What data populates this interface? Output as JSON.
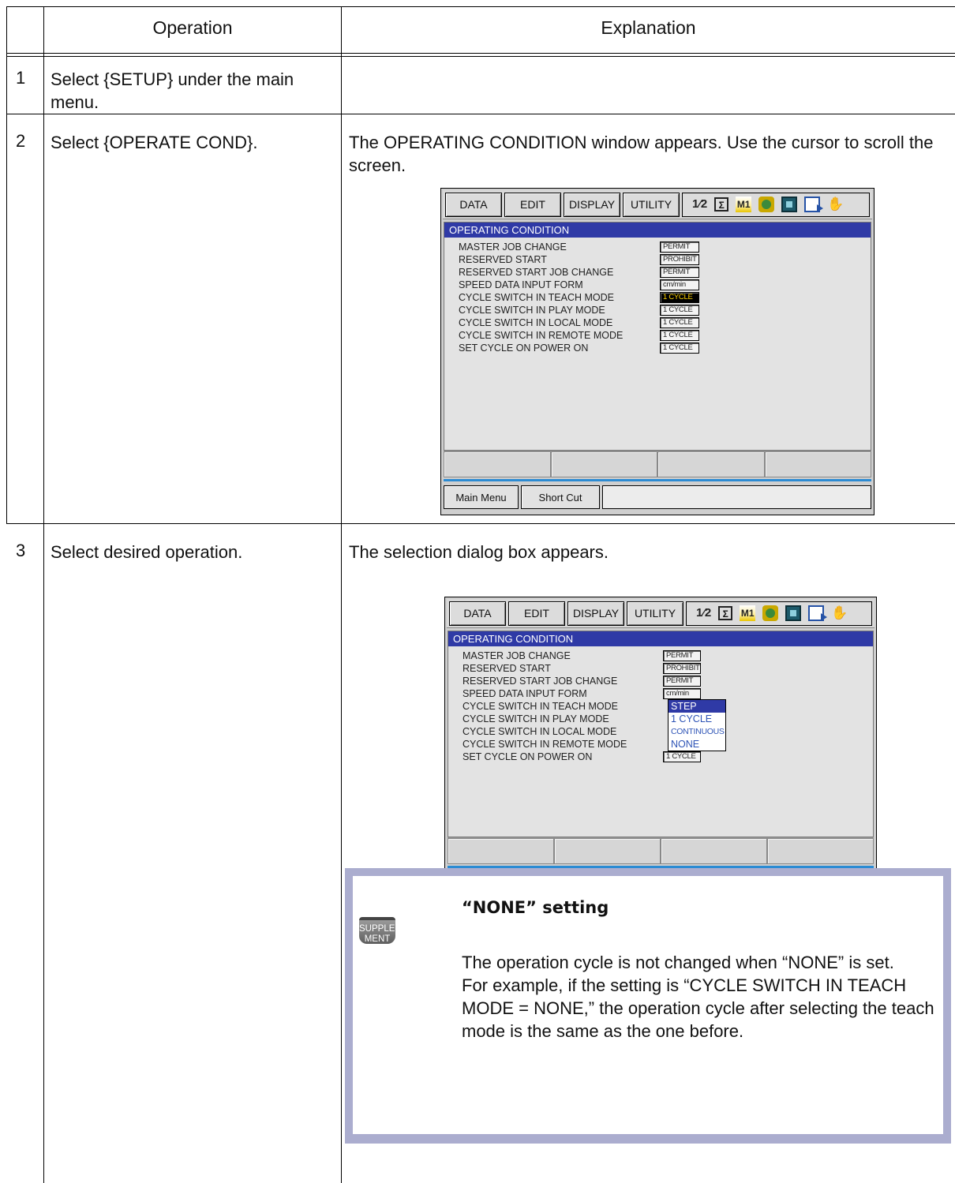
{
  "table": {
    "header": {
      "operation": "Operation",
      "explanation": "Explanation"
    },
    "steps": [
      {
        "number": "1",
        "operation": "Select {SETUP} under the main menu.",
        "explanation": ""
      },
      {
        "number": "2",
        "operation": "Select {OPERATE COND}.",
        "explanation": "The OPERATING CONDITION window appears. Use the cursor to scroll the screen."
      },
      {
        "number": "3",
        "operation": "Select desired operation.",
        "explanation": "The selection dialog box appears."
      }
    ]
  },
  "screen": {
    "menus": [
      "DATA",
      "EDIT",
      "DISPLAY",
      "UTILITY"
    ],
    "status_icons": [
      "mode-number-icon",
      "sigma-icon",
      "teach-mode-icon",
      "robot-icon",
      "display-icon",
      "exit-icon",
      "hand-icon"
    ],
    "status_icon_text": {
      "num": "1⁄2",
      "sigma": "Σ",
      "mode": "M1"
    },
    "window_title": "OPERATING CONDITION",
    "rows": [
      {
        "label": "MASTER JOB CHANGE",
        "value": "PERMIT"
      },
      {
        "label": "RESERVED START",
        "value": "PROHIBIT"
      },
      {
        "label": "RESERVED START JOB CHANGE",
        "value": "PERMIT"
      },
      {
        "label": "SPEED DATA INPUT FORM",
        "value": "cm/min"
      },
      {
        "label": "CYCLE SWITCH IN TEACH MODE",
        "value": "1 CYCLE"
      },
      {
        "label": "CYCLE SWITCH IN PLAY MODE",
        "value": "1 CYCLE"
      },
      {
        "label": "CYCLE SWITCH IN LOCAL MODE",
        "value": "1 CYCLE"
      },
      {
        "label": "CYCLE SWITCH IN REMOTE MODE",
        "value": "1 CYCLE"
      },
      {
        "label": "SET CYCLE ON POWER ON",
        "value": "1 CYCLE"
      }
    ],
    "dropdown_options": [
      "STEP",
      "1 CYCLE",
      "CONTINUOUS",
      "NONE"
    ],
    "main_menu": "Main Menu",
    "short_cut": "Short Cut"
  },
  "supplement": {
    "icon_label": "SUPPLE-\nMENT",
    "title": "“NONE” setting",
    "text": "The operation cycle is not changed when “NONE” is set.\nFor example, if the setting is “CYCLE SWITCH IN TEACH MODE = NONE,” the operation cycle after selecting the teach mode is the same as the one before."
  }
}
